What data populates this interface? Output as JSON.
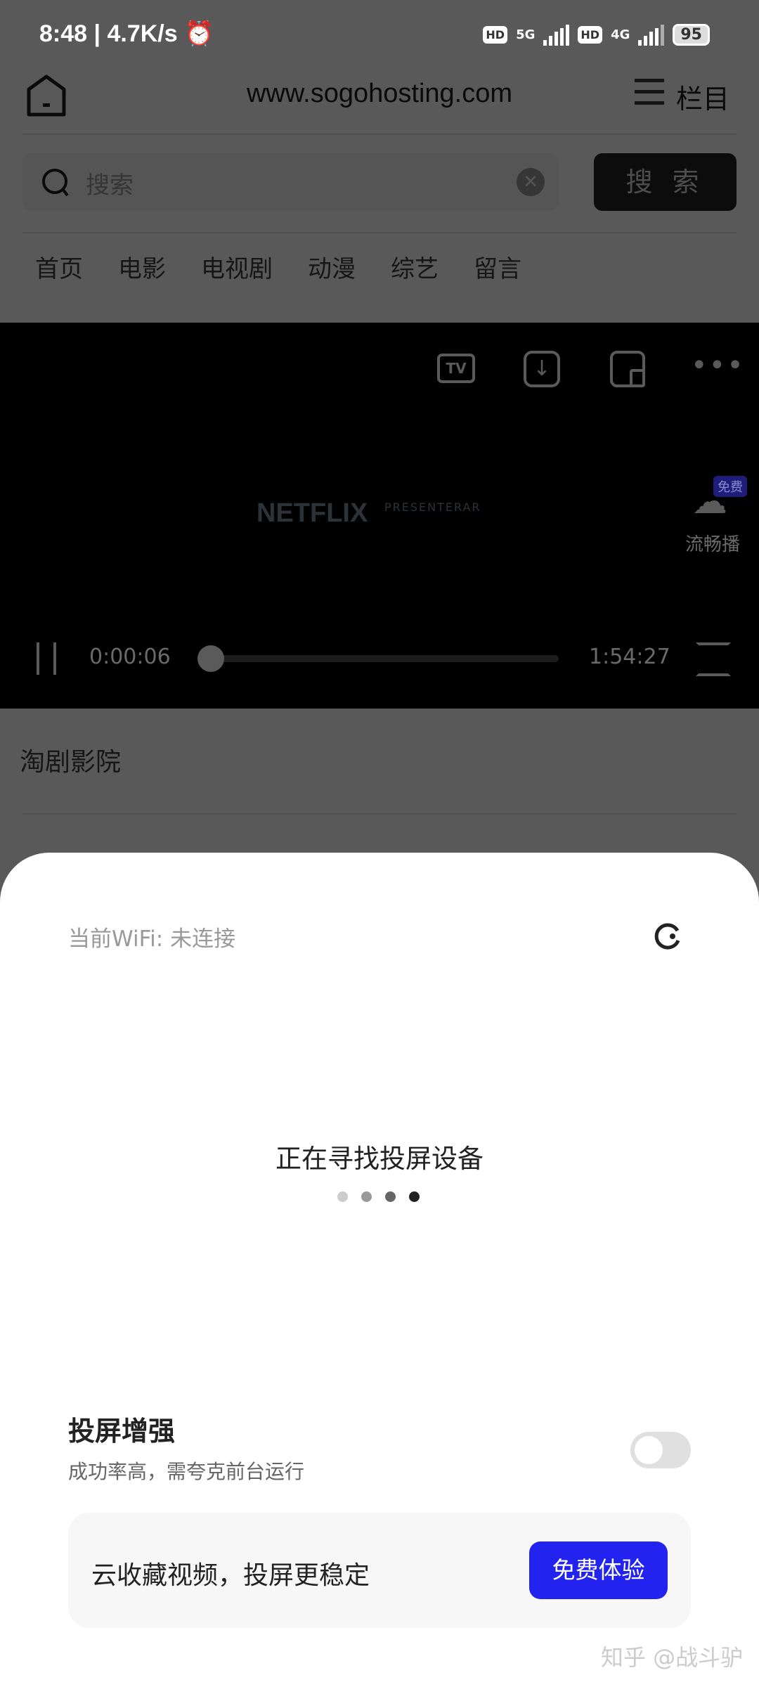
{
  "status_bar": {
    "time": "8:48",
    "speed": "4.7K/s",
    "net1": "5G",
    "net2": "4G",
    "hd": "HD",
    "battery": "95"
  },
  "header": {
    "url": "www.sogohosting.com",
    "menu_label": "栏目"
  },
  "search": {
    "placeholder": "搜索",
    "button_label": "搜 索"
  },
  "nav": {
    "tabs": [
      "首页",
      "电影",
      "电视剧",
      "动漫",
      "综艺",
      "留言"
    ]
  },
  "player": {
    "watermark_brand": "NETFLIX",
    "watermark_sub": "PRESENTERAR",
    "current_time": "0:00:06",
    "total_time": "1:54:27",
    "progress": 0.0009,
    "smooth_badge": "免费",
    "smooth_label": "流畅播",
    "tv_label": "TV"
  },
  "site_name": "淘剧影院",
  "cast_sheet": {
    "wifi_status": "当前WiFi: 未连接",
    "searching_text": "正在寻找投屏设备",
    "enhance_title": "投屏增强",
    "enhance_subtitle": "成功率高，需夸克前台运行",
    "enhance_enabled": false,
    "promo_text": "云收藏视频，投屏更稳定",
    "promo_button": "免费体验",
    "accent": "#2323f0"
  },
  "watermark": "知乎 @战斗驴"
}
